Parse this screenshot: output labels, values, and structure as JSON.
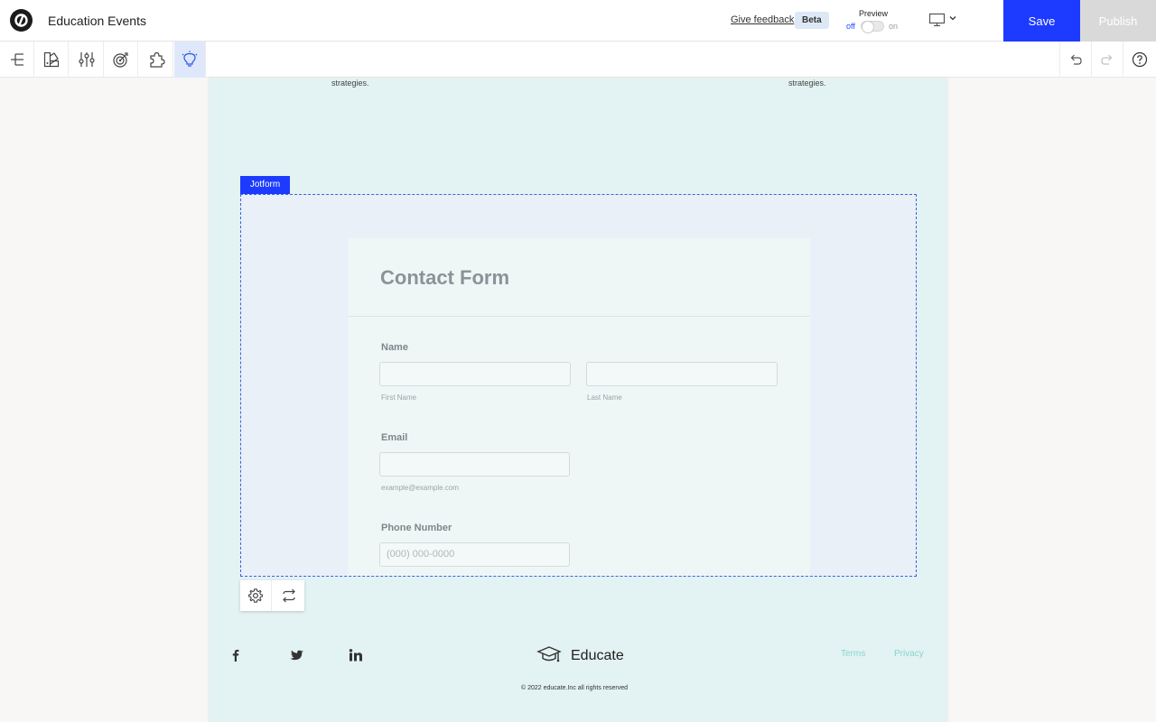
{
  "app": {
    "title": "Education Events"
  },
  "header": {
    "feedback": "Give feedback",
    "beta": "Beta",
    "preview_label": "Preview",
    "preview_off": "off",
    "preview_on": "on",
    "save": "Save",
    "publish": "Publish"
  },
  "page": {
    "strategies_left": "strategies.",
    "strategies_right": "strategies."
  },
  "jotform": {
    "tag": "Jotform",
    "title": "Contact Form",
    "name_label": "Name",
    "first_name": "First Name",
    "last_name": "Last Name",
    "email_label": "Email",
    "email_hint": "example@example.com",
    "phone_label": "Phone Number",
    "phone_placeholder": "(000) 000-0000"
  },
  "footer": {
    "brand": "Educate",
    "terms": "Terms",
    "privacy": "Privacy",
    "copyright": "© 2022 educate.Inc all rights reserved"
  },
  "colors": {
    "accent": "#1d3bff",
    "canvas": "#e3f2f2",
    "link": "#88d6cd"
  }
}
